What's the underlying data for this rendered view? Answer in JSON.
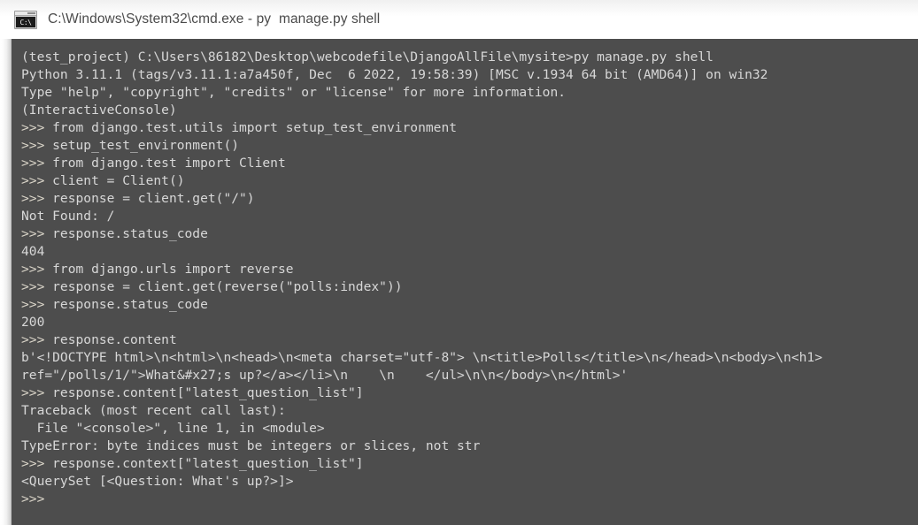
{
  "window": {
    "title": "C:\\Windows\\System32\\cmd.exe - py  manage.py shell",
    "icon": "cmd-console-icon",
    "icon_glyph": "C:\\",
    "background_color": "#4d4d4d",
    "text_color": "#d7d7d7",
    "titlebar_color": "#ffffff",
    "titlebar_text_color": "#4a4a4a"
  },
  "console": {
    "prompt_symbol": ">>>",
    "lines": [
      "(test_project) C:\\Users\\86182\\Desktop\\webcodefile\\DjangoAllFile\\mysite>py manage.py shell",
      "Python 3.11.1 (tags/v3.11.1:a7a450f, Dec  6 2022, 19:58:39) [MSC v.1934 64 bit (AMD64)] on win32",
      "Type \"help\", \"copyright\", \"credits\" or \"license\" for more information.",
      "(InteractiveConsole)",
      ">>> from django.test.utils import setup_test_environment",
      ">>> setup_test_environment()",
      ">>> from django.test import Client",
      ">>> client = Client()",
      ">>> response = client.get(\"/\")",
      "Not Found: /",
      ">>> response.status_code",
      "404",
      ">>> from django.urls import reverse",
      ">>> response = client.get(reverse(\"polls:index\"))",
      ">>> response.status_code",
      "200",
      ">>> response.content",
      "b'<!DOCTYPE html>\\n<html>\\n<head>\\n<meta charset=\"utf-8\"> \\n<title>Polls</title>\\n</head>\\n<body>\\n<h1>",
      "ref=\"/polls/1/\">What&#x27;s up?</a></li>\\n    \\n    </ul>\\n\\n</body>\\n</html>'",
      ">>> response.content[\"latest_question_list\"]",
      "Traceback (most recent call last):",
      "  File \"<console>\", line 1, in <module>",
      "TypeError: byte indices must be integers or slices, not str",
      ">>> response.context[\"latest_question_list\"]",
      "<QuerySet [<Question: What's up?>]>",
      ">>>"
    ]
  }
}
